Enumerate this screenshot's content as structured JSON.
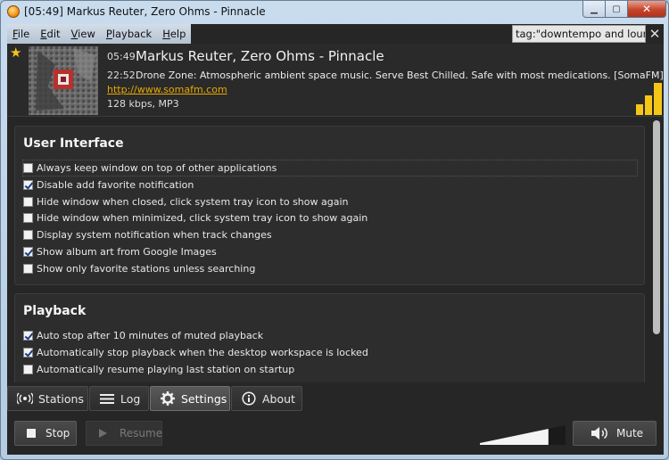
{
  "window": {
    "title": "[05:49] Markus Reuter, Zero Ohms - Pinnacle",
    "controls": {
      "minimize": "▁",
      "maximize": "▢",
      "close": "✕"
    }
  },
  "menu": {
    "items": [
      {
        "label": "File",
        "accel": "F",
        "rest": "ile"
      },
      {
        "label": "Edit",
        "accel": "E",
        "rest": "dit"
      },
      {
        "label": "View",
        "accel": "V",
        "rest": "iew"
      },
      {
        "label": "Playback",
        "accel": "P",
        "rest": "layback"
      },
      {
        "label": "Help",
        "accel": "H",
        "rest": "elp"
      }
    ],
    "search_value": "tag:\"downtempo and lounge\"",
    "clear_glyph": "✕"
  },
  "now_playing": {
    "favorite_glyph": "★",
    "track_time": "05:49",
    "track_title": "Markus Reuter, Zero Ohms - Pinnacle",
    "station_time": "22:52",
    "station_description": "Drone Zone: Atmospheric ambient space music. Serve Best Chilled. Safe with most medications. [SomaFM]",
    "station_url": "http://www.somafm.com",
    "bitrate_format": "128 kbps, MP3",
    "signal_strength": 0.66,
    "accent_color": "#f5c518"
  },
  "settings": {
    "user_interface": {
      "title": "User Interface",
      "options": [
        {
          "label": "Always keep window on top of other applications",
          "checked": false
        },
        {
          "label": "Disable add favorite notification",
          "checked": true
        },
        {
          "label": "Hide window when closed, click system tray icon to show again",
          "checked": false
        },
        {
          "label": "Hide window when minimized, click system tray icon to show again",
          "checked": false
        },
        {
          "label": "Display system notification when track changes",
          "checked": false
        },
        {
          "label": "Show album art from Google Images",
          "checked": true
        },
        {
          "label": "Show only favorite stations unless searching",
          "checked": false
        }
      ]
    },
    "playback": {
      "title": "Playback",
      "options": [
        {
          "label": "Auto stop after 10 minutes of muted playback",
          "checked": true
        },
        {
          "label": "Automatically stop playback when the desktop workspace is locked",
          "checked": true
        },
        {
          "label": "Automatically resume playing last station on startup",
          "checked": false
        }
      ]
    }
  },
  "tabs": [
    {
      "label": "Stations",
      "icon": "broadcast-icon",
      "glyph": "((•))",
      "active": false
    },
    {
      "label": "Log",
      "icon": "list-icon",
      "glyph": "☰",
      "active": false
    },
    {
      "label": "Settings",
      "icon": "gear-icon",
      "glyph": "⚙",
      "active": true
    },
    {
      "label": "About",
      "icon": "info-icon",
      "glyph": "ⓘ",
      "active": false
    }
  ],
  "controls": {
    "stop_label": "Stop",
    "resume_label": "Resume",
    "mute_label": "Mute",
    "volume_level": 0.8,
    "volume_glyph": "🔊"
  }
}
